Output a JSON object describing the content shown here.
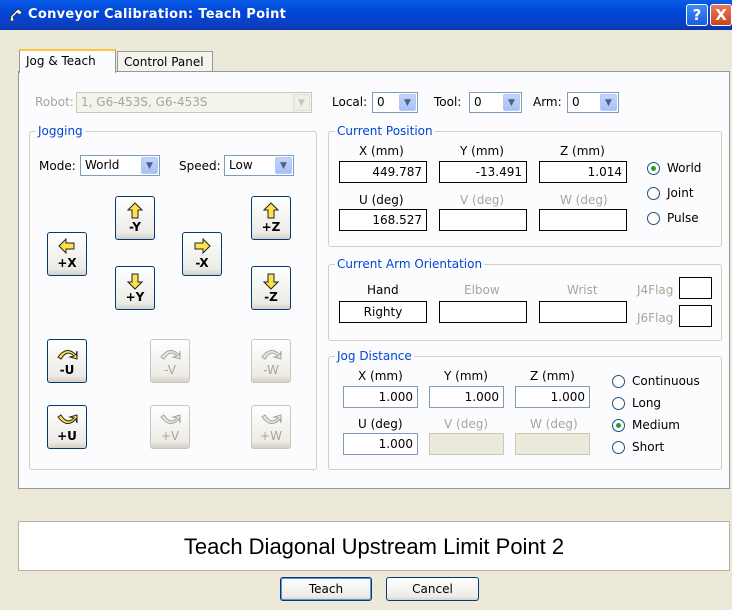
{
  "window": {
    "title": "Conveyor Calibration: Teach Point",
    "help_label": "?",
    "close_label": "X"
  },
  "tabs": [
    {
      "label": "Jog & Teach",
      "active": true
    },
    {
      "label": "Control Panel",
      "active": false
    }
  ],
  "robot": {
    "label": "Robot:",
    "value": "1, G6-453S, G6-453S"
  },
  "local": {
    "label": "Local:",
    "value": "0"
  },
  "tool": {
    "label": "Tool:",
    "value": "0"
  },
  "arm": {
    "label": "Arm:",
    "value": "0"
  },
  "jogging": {
    "title": "Jogging",
    "mode_label": "Mode:",
    "mode_value": "World",
    "speed_label": "Speed:",
    "speed_value": "Low",
    "buttons": {
      "neg_y": "-Y",
      "pos_x": "+X",
      "pos_y": "+Y",
      "neg_x": "-X",
      "pos_z": "+Z",
      "neg_z": "-Z",
      "neg_u": "-U",
      "neg_v": "-V",
      "neg_w": "-W",
      "pos_u": "+U",
      "pos_v": "+V",
      "pos_w": "+W"
    }
  },
  "current_position": {
    "title": "Current Position",
    "x_label": "X (mm)",
    "x_value": "449.787",
    "y_label": "Y (mm)",
    "y_value": "-13.491",
    "z_label": "Z (mm)",
    "z_value": "1.014",
    "u_label": "U (deg)",
    "u_value": "168.527",
    "v_label": "V (deg)",
    "v_value": "",
    "w_label": "W (deg)",
    "w_value": "",
    "modes": [
      {
        "label": "World",
        "checked": true
      },
      {
        "label": "Joint",
        "checked": false
      },
      {
        "label": "Pulse",
        "checked": false
      }
    ]
  },
  "arm_orientation": {
    "title": "Current Arm Orientation",
    "hand_label": "Hand",
    "hand_value": "Righty",
    "elbow_label": "Elbow",
    "elbow_value": "",
    "wrist_label": "Wrist",
    "wrist_value": "",
    "j4flag_label": "J4Flag",
    "j6flag_label": "J6Flag"
  },
  "jog_distance": {
    "title": "Jog Distance",
    "x_label": "X (mm)",
    "x_value": "1.000",
    "y_label": "Y (mm)",
    "y_value": "1.000",
    "z_label": "Z (mm)",
    "z_value": "1.000",
    "u_label": "U (deg)",
    "u_value": "1.000",
    "v_label": "V (deg)",
    "w_label": "W (deg)",
    "options": [
      {
        "label": "Continuous",
        "checked": false
      },
      {
        "label": "Long",
        "checked": false
      },
      {
        "label": "Medium",
        "checked": true
      },
      {
        "label": "Short",
        "checked": false
      }
    ]
  },
  "instruction": "Teach Diagonal Upstream Limit Point 2",
  "footer": {
    "teach_label": "Teach",
    "cancel_label": "Cancel"
  },
  "colors": {
    "titlebar": "#0046d8",
    "group_title": "#0046d5",
    "tab_highlight": "#ffc83c"
  }
}
